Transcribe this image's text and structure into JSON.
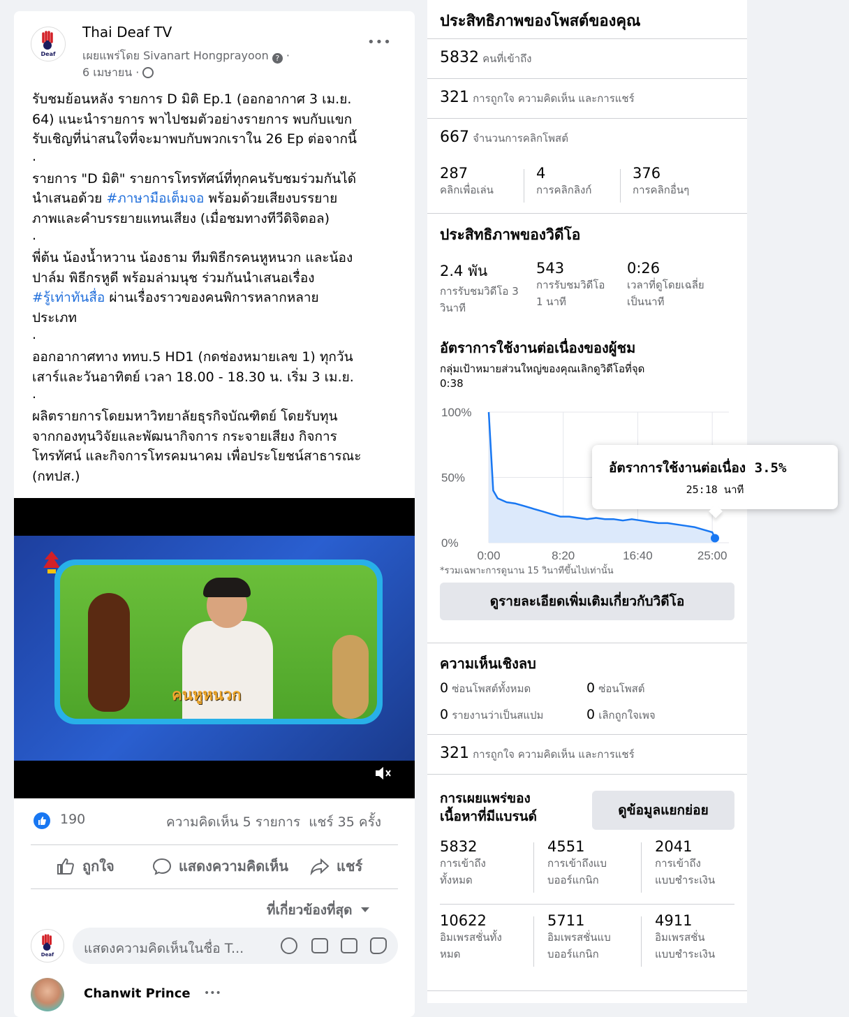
{
  "post": {
    "page_name": "Thai Deaf TV",
    "published_by": "เผยแพร่โดย Sivanart Hongprayoon",
    "date": "6 เมษายน ·",
    "more": "•••",
    "avatar_text": "Deaf",
    "paragraphs": [
      [
        "รับชมย้อนหลัง รายการ D มิติ Ep.1 (ออกอากาศ 3 เม.ย.",
        "64) แนะนำรายการ พาไปชมตัวอย่างรายการ พบกับแขก",
        "รับเชิญที่น่าสนใจที่จะมาพบกับพวกเราใน 26 Ep ต่อจากนี้"
      ],
      [
        "รายการ \"D มิติ\" รายการโทรทัศน์ที่ทุกคนรับชมร่วมกันได้"
      ],
      [
        "ภาพและคำบรรยายแทนเสียง (เมื่อชมทางทีวีดิจิตอล)"
      ],
      [
        "พี่ต้น น้องน้ำหวาน น้องธาม ทีมพิธีกรคนหูหนวก และน้อง",
        "ปาล์ม พิธีกรหูดี พร้อมล่ามนุช ร่วมกันนำเสนอเรื่อง"
      ],
      [
        "ประเภท"
      ],
      [
        "ออกอากาศทาง ททบ.5 HD1 (กดช่องหมายเลข 1) ทุกวัน",
        "เสาร์และวันอาทิตย์ เวลา 18.00 - 18.30 น. เริ่ม 3 เม.ย."
      ],
      [
        "ผลิตรายการโดยมหาวิทยาลัยธุรกิจบัณฑิตย์ โดยรับทุน",
        "จากกองทุนวิจัยและพัฒนากิจการ กระจายเสียง กิจการ",
        "โทรทัศน์ และกิจการโทรคมนาคม เพื่อประโยชน์สาธารณะ",
        "(กทปส.)"
      ]
    ],
    "line_presenter_a": "นำเสนอด้วย ",
    "hashtag_1": "#ภาษามือเต็มจอ",
    "line_presenter_b": " พร้อมด้วยเสียงบรรยาย",
    "hashtag_2": "#รู้เท่าทันสื่อ",
    "line_hashtag2_b": " ผ่านเรื่องราวของคนพิการหลากหลาย",
    "dot": ".",
    "video_caption": "คนหูหนวก",
    "reactions_count": "190",
    "comments_shares": "ความคิดเห็น 5 รายการ  แชร์ 35 ครั้ง",
    "like_label": "ถูกใจ",
    "comment_label": "แสดงความคิดเห็น",
    "share_label": "แชร์",
    "sort_label": "ที่เกี่ยวข้องที่สุด",
    "comment_placeholder": "แสดงความคิดเห็นในชื่อ T...",
    "commenter_name": "Chanwit Prince",
    "commenter_more": "•••"
  },
  "panel": {
    "header": "ประสิทธิภาพของโพสต์ของคุณ",
    "reach": {
      "value": "5832",
      "label": "คนที่เข้าถึง"
    },
    "engagement": {
      "value": "321",
      "label": "การถูกใจ ความคิดเห็น และการแชร์"
    },
    "clicks": {
      "value": "667",
      "label": "จำนวนการคลิกโพสต์"
    },
    "click_breakdown": [
      {
        "value": "287",
        "label": "คลิกเพื่อเล่น"
      },
      {
        "value": "4",
        "label": "การคลิกลิงก์"
      },
      {
        "value": "376",
        "label": "การคลิกอื่นๆ"
      }
    ],
    "video_title": "ประสิทธิภาพของวิดีโอ",
    "video_stats": [
      {
        "value": "2.4 พัน",
        "label1": "การรับชมวิดีโอ 3",
        "label2": "วินาที"
      },
      {
        "value": "543",
        "label1": "การรับชมวิดีโอ",
        "label2": "1 นาที"
      },
      {
        "value": "0:26",
        "label1": "เวลาที่ดูโดยเฉลี่ย",
        "label2": "เป็นนาที"
      }
    ],
    "retention_title": "อัตราการใช้งานต่อเนื่องของผู้ชม",
    "retention_sub1": "กลุ่มเป้าหมายส่วนใหญ่ของคุณเลิกดูวิดีโอที่จุด",
    "retention_sub2": "0:38",
    "chart_note": "*รวมเฉพาะการดูนาน 15 วินาทีขึ้นไปเท่านั้น",
    "more_video_btn": "ดูรายละเอียดเพิ่มเติมเกี่ยวกับวิดีโอ",
    "tooltip_title": "อัตราการใช้งานต่อเนื่อง",
    "tooltip_value": "3.5%",
    "tooltip_time": "25:18 นาที",
    "negative_title": "ความเห็นเชิงลบ",
    "negative": [
      {
        "value": "0",
        "label": "ซ่อนโพสต์ทั้งหมด"
      },
      {
        "value": "0",
        "label": "ซ่อนโพสต์"
      },
      {
        "value": "0",
        "label": "รายงานว่าเป็นสแปม"
      },
      {
        "value": "0",
        "label": "เลิกถูกใจเพจ"
      }
    ],
    "engagement2": {
      "value": "321",
      "label": "การถูกใจ ความคิดเห็น และการแชร์"
    },
    "branded_title1": "การเผยแพร่ของ",
    "branded_title2": "เนื้อหาที่มีแบรนด์",
    "branded_btn": "ดูข้อมูลแยกย่อย",
    "branded_reach": [
      {
        "value": "5832",
        "label1": "การเข้าถึง",
        "label2": "ทั้งหมด"
      },
      {
        "value": "4551",
        "label1": "การเข้าถึงแบ",
        "label2": "บออร์แกนิก"
      },
      {
        "value": "2041",
        "label1": "การเข้าถึง",
        "label2": "แบบชำระเงิน"
      }
    ],
    "branded_impr": [
      {
        "value": "10622",
        "label1": "อิมเพรสชั่นทั้ง",
        "label2": "หมด"
      },
      {
        "value": "5711",
        "label1": "อิมเพรสชั่นแบ",
        "label2": "บออร์แกนิก"
      },
      {
        "value": "4911",
        "label1": "อิมเพรสชั่น",
        "label2": "แบบชำระเงิน"
      }
    ]
  },
  "chart_data": {
    "type": "area",
    "title": "",
    "xlabel": "",
    "ylabel": "",
    "x_ticks": [
      "0:00",
      "8:20",
      "16:40",
      "25:00"
    ],
    "y_ticks": [
      "100%",
      "50%",
      "0%"
    ],
    "xlim_seconds": [
      0,
      1518
    ],
    "ylim": [
      0,
      100
    ],
    "x_seconds": [
      0,
      30,
      60,
      120,
      180,
      240,
      300,
      360,
      420,
      480,
      540,
      600,
      660,
      720,
      780,
      840,
      900,
      960,
      1020,
      1080,
      1140,
      1200,
      1260,
      1320,
      1380,
      1440,
      1500,
      1518
    ],
    "values": [
      100,
      40,
      34,
      31,
      30,
      28,
      26,
      24,
      22,
      20,
      20,
      19,
      18,
      19,
      18,
      18,
      17,
      18,
      17,
      16,
      15,
      15,
      14,
      13,
      12,
      10,
      8,
      3.5
    ],
    "color": "#1877f2",
    "fill": "#dce9fb"
  }
}
